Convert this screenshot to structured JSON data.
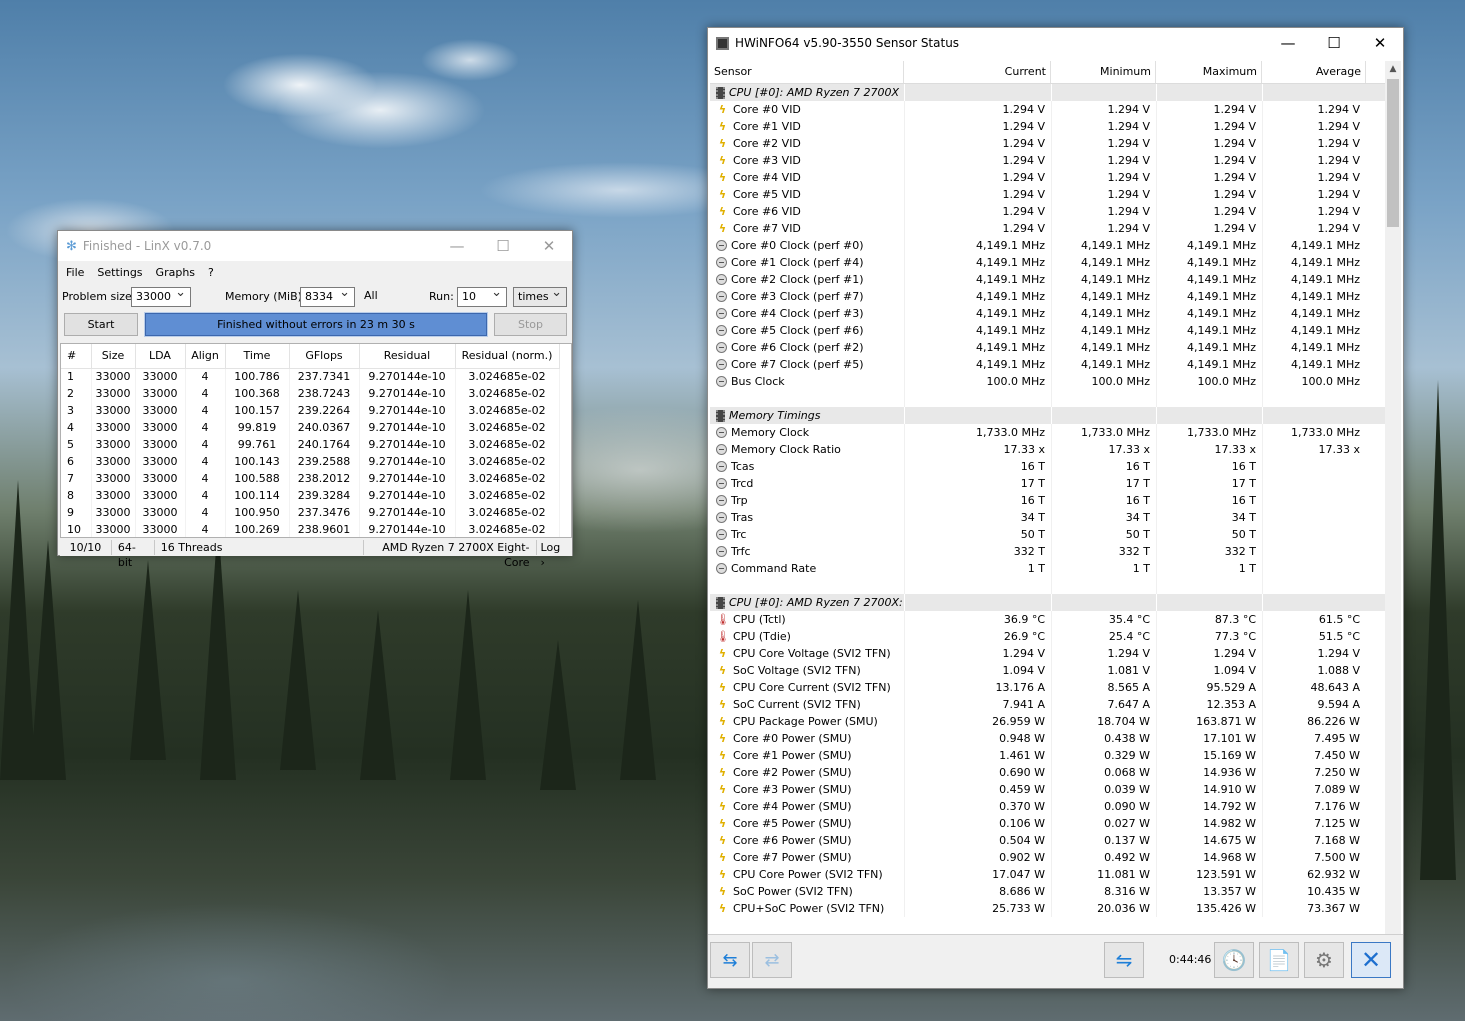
{
  "linx": {
    "title": "Finished - LinX v0.7.0",
    "menu": [
      "File",
      "Settings",
      "Graphs",
      "?"
    ],
    "problem_size_label": "Problem size:",
    "problem_size": "33000",
    "memory_label": "Memory (MiB):",
    "memory": "8334",
    "all_label": "All",
    "run_label": "Run:",
    "run": "10",
    "times": "times",
    "start": "Start",
    "progress_text": "Finished without errors in 23 m 30 s",
    "progress": 1.0,
    "stop": "Stop",
    "columns": [
      "#",
      "Size",
      "LDA",
      "Align",
      "Time",
      "GFlops",
      "Residual",
      "Residual (norm.)"
    ],
    "rows": [
      [
        "1",
        "33000",
        "33000",
        "4",
        "100.786",
        "237.7341",
        "9.270144e-10",
        "3.024685e-02"
      ],
      [
        "2",
        "33000",
        "33000",
        "4",
        "100.368",
        "238.7243",
        "9.270144e-10",
        "3.024685e-02"
      ],
      [
        "3",
        "33000",
        "33000",
        "4",
        "100.157",
        "239.2264",
        "9.270144e-10",
        "3.024685e-02"
      ],
      [
        "4",
        "33000",
        "33000",
        "4",
        "99.819",
        "240.0367",
        "9.270144e-10",
        "3.024685e-02"
      ],
      [
        "5",
        "33000",
        "33000",
        "4",
        "99.761",
        "240.1764",
        "9.270144e-10",
        "3.024685e-02"
      ],
      [
        "6",
        "33000",
        "33000",
        "4",
        "100.143",
        "239.2588",
        "9.270144e-10",
        "3.024685e-02"
      ],
      [
        "7",
        "33000",
        "33000",
        "4",
        "100.588",
        "238.2012",
        "9.270144e-10",
        "3.024685e-02"
      ],
      [
        "8",
        "33000",
        "33000",
        "4",
        "100.114",
        "239.3284",
        "9.270144e-10",
        "3.024685e-02"
      ],
      [
        "9",
        "33000",
        "33000",
        "4",
        "100.950",
        "237.3476",
        "9.270144e-10",
        "3.024685e-02"
      ],
      [
        "10",
        "33000",
        "33000",
        "4",
        "100.269",
        "238.9601",
        "9.270144e-10",
        "3.024685e-02"
      ]
    ],
    "status": [
      "10/10",
      "64-bit",
      "16 Threads",
      "AMD Ryzen 7 2700X Eight-Core",
      "Log ›"
    ]
  },
  "hw": {
    "title": "HWiNFO64 v5.90-3550 Sensor Status",
    "columns": [
      "Sensor",
      "Current",
      "Minimum",
      "Maximum",
      "Average"
    ],
    "rows": [
      {
        "t": "grp",
        "icon": "chip",
        "n": "CPU [#0]: AMD Ryzen 7 2700X"
      },
      {
        "icon": "volt",
        "n": "Core #0 VID",
        "v": [
          "1.294 V",
          "1.294 V",
          "1.294 V",
          "1.294 V"
        ]
      },
      {
        "icon": "volt",
        "n": "Core #1 VID",
        "v": [
          "1.294 V",
          "1.294 V",
          "1.294 V",
          "1.294 V"
        ]
      },
      {
        "icon": "volt",
        "n": "Core #2 VID",
        "v": [
          "1.294 V",
          "1.294 V",
          "1.294 V",
          "1.294 V"
        ]
      },
      {
        "icon": "volt",
        "n": "Core #3 VID",
        "v": [
          "1.294 V",
          "1.294 V",
          "1.294 V",
          "1.294 V"
        ]
      },
      {
        "icon": "volt",
        "n": "Core #4 VID",
        "v": [
          "1.294 V",
          "1.294 V",
          "1.294 V",
          "1.294 V"
        ]
      },
      {
        "icon": "volt",
        "n": "Core #5 VID",
        "v": [
          "1.294 V",
          "1.294 V",
          "1.294 V",
          "1.294 V"
        ]
      },
      {
        "icon": "volt",
        "n": "Core #6 VID",
        "v": [
          "1.294 V",
          "1.294 V",
          "1.294 V",
          "1.294 V"
        ]
      },
      {
        "icon": "volt",
        "n": "Core #7 VID",
        "v": [
          "1.294 V",
          "1.294 V",
          "1.294 V",
          "1.294 V"
        ]
      },
      {
        "icon": "clk",
        "n": "Core #0 Clock (perf #0)",
        "v": [
          "4,149.1 MHz",
          "4,149.1 MHz",
          "4,149.1 MHz",
          "4,149.1 MHz"
        ]
      },
      {
        "icon": "clk",
        "n": "Core #1 Clock (perf #4)",
        "v": [
          "4,149.1 MHz",
          "4,149.1 MHz",
          "4,149.1 MHz",
          "4,149.1 MHz"
        ]
      },
      {
        "icon": "clk",
        "n": "Core #2 Clock (perf #1)",
        "v": [
          "4,149.1 MHz",
          "4,149.1 MHz",
          "4,149.1 MHz",
          "4,149.1 MHz"
        ]
      },
      {
        "icon": "clk",
        "n": "Core #3 Clock (perf #7)",
        "v": [
          "4,149.1 MHz",
          "4,149.1 MHz",
          "4,149.1 MHz",
          "4,149.1 MHz"
        ]
      },
      {
        "icon": "clk",
        "n": "Core #4 Clock (perf #3)",
        "v": [
          "4,149.1 MHz",
          "4,149.1 MHz",
          "4,149.1 MHz",
          "4,149.1 MHz"
        ]
      },
      {
        "icon": "clk",
        "n": "Core #5 Clock (perf #6)",
        "v": [
          "4,149.1 MHz",
          "4,149.1 MHz",
          "4,149.1 MHz",
          "4,149.1 MHz"
        ]
      },
      {
        "icon": "clk",
        "n": "Core #6 Clock (perf #2)",
        "v": [
          "4,149.1 MHz",
          "4,149.1 MHz",
          "4,149.1 MHz",
          "4,149.1 MHz"
        ]
      },
      {
        "icon": "clk",
        "n": "Core #7 Clock (perf #5)",
        "v": [
          "4,149.1 MHz",
          "4,149.1 MHz",
          "4,149.1 MHz",
          "4,149.1 MHz"
        ]
      },
      {
        "icon": "clk",
        "n": "Bus Clock",
        "v": [
          "100.0 MHz",
          "100.0 MHz",
          "100.0 MHz",
          "100.0 MHz"
        ]
      },
      {
        "t": "blank"
      },
      {
        "t": "grp",
        "icon": "chip",
        "n": "Memory Timings"
      },
      {
        "icon": "clk",
        "n": "Memory Clock",
        "v": [
          "1,733.0 MHz",
          "1,733.0 MHz",
          "1,733.0 MHz",
          "1,733.0 MHz"
        ]
      },
      {
        "icon": "clk",
        "n": "Memory Clock Ratio",
        "v": [
          "17.33 x",
          "17.33 x",
          "17.33 x",
          "17.33 x"
        ]
      },
      {
        "icon": "clk",
        "n": "Tcas",
        "v": [
          "16 T",
          "16 T",
          "16 T",
          ""
        ]
      },
      {
        "icon": "clk",
        "n": "Trcd",
        "v": [
          "17 T",
          "17 T",
          "17 T",
          ""
        ]
      },
      {
        "icon": "clk",
        "n": "Trp",
        "v": [
          "16 T",
          "16 T",
          "16 T",
          ""
        ]
      },
      {
        "icon": "clk",
        "n": "Tras",
        "v": [
          "34 T",
          "34 T",
          "34 T",
          ""
        ]
      },
      {
        "icon": "clk",
        "n": "Trc",
        "v": [
          "50 T",
          "50 T",
          "50 T",
          ""
        ]
      },
      {
        "icon": "clk",
        "n": "Trfc",
        "v": [
          "332 T",
          "332 T",
          "332 T",
          ""
        ]
      },
      {
        "icon": "clk",
        "n": "Command Rate",
        "v": [
          "1 T",
          "1 T",
          "1 T",
          ""
        ]
      },
      {
        "t": "blank"
      },
      {
        "t": "grp",
        "icon": "chip",
        "n": "CPU [#0]: AMD Ryzen 7 2700X: ..."
      },
      {
        "icon": "temp",
        "n": "CPU (Tctl)",
        "v": [
          "36.9 °C",
          "35.4 °C",
          "87.3 °C",
          "61.5 °C"
        ]
      },
      {
        "icon": "temp",
        "n": "CPU (Tdie)",
        "v": [
          "26.9 °C",
          "25.4 °C",
          "77.3 °C",
          "51.5 °C"
        ]
      },
      {
        "icon": "volt",
        "n": "CPU Core Voltage (SVI2 TFN)",
        "v": [
          "1.294 V",
          "1.294 V",
          "1.294 V",
          "1.294 V"
        ]
      },
      {
        "icon": "volt",
        "n": "SoC Voltage (SVI2 TFN)",
        "v": [
          "1.094 V",
          "1.081 V",
          "1.094 V",
          "1.088 V"
        ]
      },
      {
        "icon": "volt",
        "n": "CPU Core Current (SVI2 TFN)",
        "v": [
          "13.176 A",
          "8.565 A",
          "95.529 A",
          "48.643 A"
        ]
      },
      {
        "icon": "volt",
        "n": "SoC Current (SVI2 TFN)",
        "v": [
          "7.941 A",
          "7.647 A",
          "12.353 A",
          "9.594 A"
        ]
      },
      {
        "icon": "volt",
        "n": "CPU Package Power (SMU)",
        "v": [
          "26.959 W",
          "18.704 W",
          "163.871 W",
          "86.226 W"
        ]
      },
      {
        "icon": "volt",
        "n": "Core #0 Power (SMU)",
        "v": [
          "0.948 W",
          "0.438 W",
          "17.101 W",
          "7.495 W"
        ]
      },
      {
        "icon": "volt",
        "n": "Core #1 Power (SMU)",
        "v": [
          "1.461 W",
          "0.329 W",
          "15.169 W",
          "7.450 W"
        ]
      },
      {
        "icon": "volt",
        "n": "Core #2 Power (SMU)",
        "v": [
          "0.690 W",
          "0.068 W",
          "14.936 W",
          "7.250 W"
        ]
      },
      {
        "icon": "volt",
        "n": "Core #3 Power (SMU)",
        "v": [
          "0.459 W",
          "0.039 W",
          "14.910 W",
          "7.089 W"
        ]
      },
      {
        "icon": "volt",
        "n": "Core #4 Power (SMU)",
        "v": [
          "0.370 W",
          "0.090 W",
          "14.792 W",
          "7.176 W"
        ]
      },
      {
        "icon": "volt",
        "n": "Core #5 Power (SMU)",
        "v": [
          "0.106 W",
          "0.027 W",
          "14.982 W",
          "7.125 W"
        ]
      },
      {
        "icon": "volt",
        "n": "Core #6 Power (SMU)",
        "v": [
          "0.504 W",
          "0.137 W",
          "14.675 W",
          "7.168 W"
        ]
      },
      {
        "icon": "volt",
        "n": "Core #7 Power (SMU)",
        "v": [
          "0.902 W",
          "0.492 W",
          "14.968 W",
          "7.500 W"
        ]
      },
      {
        "icon": "volt",
        "n": "CPU Core Power (SVI2 TFN)",
        "v": [
          "17.047 W",
          "11.081 W",
          "123.591 W",
          "62.932 W"
        ]
      },
      {
        "icon": "volt",
        "n": "SoC Power (SVI2 TFN)",
        "v": [
          "8.686 W",
          "8.316 W",
          "13.357 W",
          "10.435 W"
        ]
      },
      {
        "icon": "volt",
        "n": "CPU+SoC Power (SVI2 TFN)",
        "v": [
          "25.733 W",
          "20.036 W",
          "135.426 W",
          "73.367 W"
        ]
      }
    ],
    "timer": "0:44:46"
  }
}
